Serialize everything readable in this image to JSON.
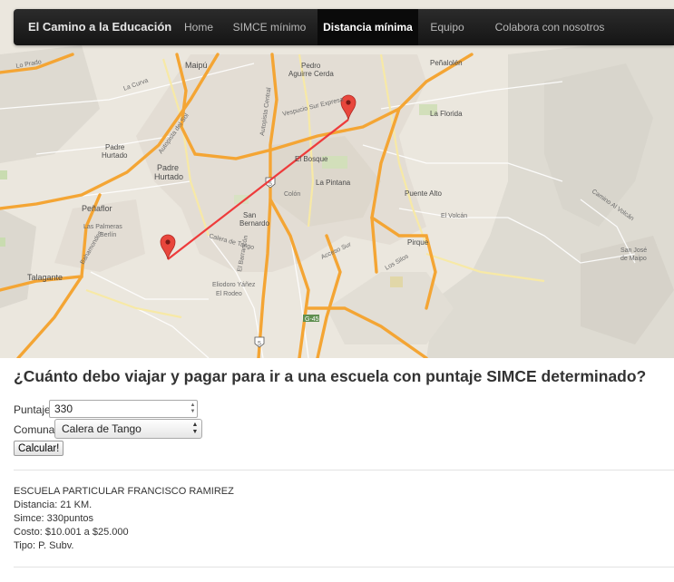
{
  "navbar": {
    "brand": "El Camino a la Educación",
    "items": [
      "Home",
      "SIMCE mínimo",
      "Distancia mínima",
      "Equipo",
      "Colabora con nosotros"
    ],
    "active": "Distancia mínima"
  },
  "map": {
    "labels": {
      "maipu": "Maipú",
      "pedro_aguirre_cerda": [
        "Pedro",
        "Aguirre Cerda"
      ],
      "penalolen": "Peñalolén",
      "la_florida": "La Florida",
      "padre_hurtado_small": [
        "Padre",
        "Hurtado"
      ],
      "padre_hurtado": [
        "Padre",
        "Hurtado"
      ],
      "el_bosque": "El Bosque",
      "la_pintana": "La Pintana",
      "penaflor": "Peñaflor",
      "san_bernardo": [
        "San",
        "Bernardo"
      ],
      "puente_alto": "Puente Alto",
      "pirque": "Pirque",
      "talagante": "Talagante",
      "san_jose_de_maipo": [
        "San José",
        "de Maipo"
      ],
      "vespucio_sur_expresa": "Vespucio Sur Expresa",
      "autopista_del_sol": "Autopista del Sol",
      "autopista_central": "Autopista Central",
      "acceso_sur": "Acceso Sur",
      "calera_de_tango_road": "Calera de Tango",
      "camino_al_volcan": "Camino Al Volcán",
      "el_volcan": "El Volcán",
      "route_5": "5",
      "route_g45": "G-45",
      "los_silos": "Los Silos",
      "lo_herrera": "El Rodeo",
      "eliodoro_yanez": "Eliodoro Yáñez",
      "el_barrancon": "El Barrancón",
      "las_palmeras": "Las Palmeras",
      "berlin": "Berlín",
      "bahamondes": "Bahamondes",
      "lo_prado": "Lo Prado",
      "la_curva": "La Curva",
      "colon": "Colón"
    }
  },
  "form": {
    "heading": "¿Cuánto debo viajar y pagar para ir a una escuela con puntaje SIMCE determinado?",
    "puntaje_label": "Puntaje",
    "puntaje_value": "330",
    "comuna_label": "Comuna",
    "comuna_value": "Calera de Tango",
    "calcular": "Calcular!"
  },
  "result": {
    "school": "ESCUELA PARTICULAR FRANCISCO RAMIREZ",
    "distancia": "Distancia: 21 KM.",
    "simce": "Simce: 330puntos",
    "costo": "Costo: $10.001 a $25.000",
    "tipo": "Tipo: P. Subv."
  }
}
